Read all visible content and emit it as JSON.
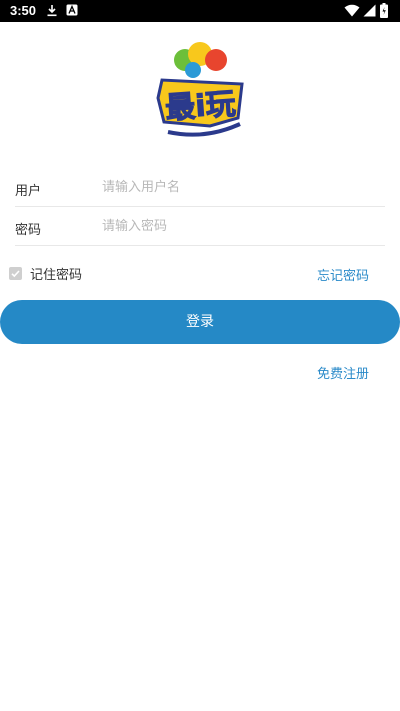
{
  "status_bar": {
    "time": "3:50",
    "icons": [
      "download-icon",
      "app-notification-icon",
      "wifi-icon",
      "signal-icon",
      "battery-icon"
    ]
  },
  "logo": {
    "text": "最i玩",
    "colors": {
      "yellow": "#f8c81c",
      "blue": "#2b3a8c",
      "green": "#6cbf3a",
      "red": "#e8452e"
    }
  },
  "form": {
    "username": {
      "label": "用户",
      "placeholder": "请输入用户名",
      "value": ""
    },
    "password": {
      "label": "密码",
      "placeholder": "请输入密码",
      "value": ""
    }
  },
  "remember": {
    "label": "记住密码",
    "checked": true
  },
  "forgot": {
    "label": "忘记密码"
  },
  "login": {
    "label": "登录"
  },
  "register": {
    "label": "免费注册"
  },
  "colors": {
    "accent": "#2589c6",
    "link": "#2a8ac9",
    "divider": "#e8e8e8"
  }
}
